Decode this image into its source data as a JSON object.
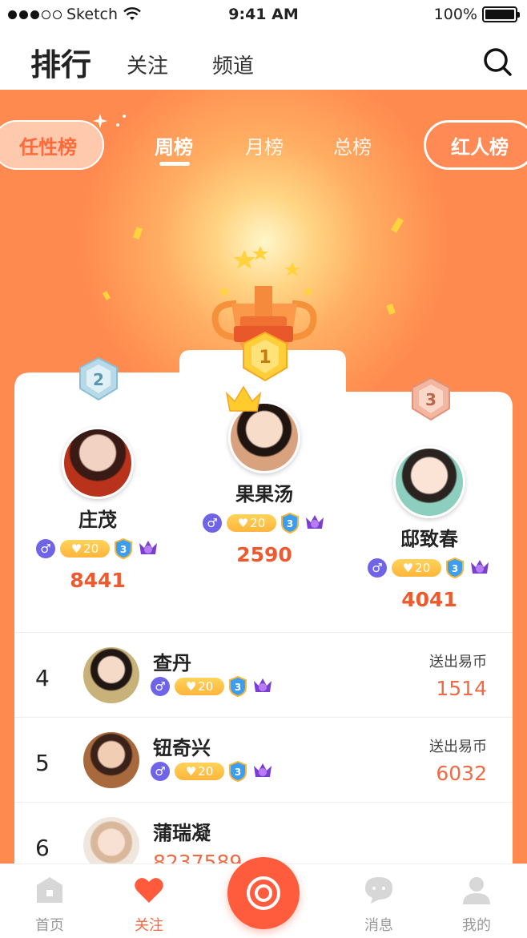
{
  "status_bar": {
    "carrier": "Sketch",
    "time": "9:41 AM",
    "battery": "100%"
  },
  "nav": {
    "title": "排行",
    "tabs": [
      "关注",
      "频道"
    ],
    "search_icon": "search-icon"
  },
  "header": {
    "left_pill": "任性榜",
    "right_pill": "红人榜",
    "range_tabs": [
      "周榜",
      "月榜",
      "总榜"
    ],
    "active_range": "周榜"
  },
  "podium": [
    {
      "rank": "2",
      "name": "庄茂",
      "gender": "♂",
      "likes": "20",
      "level": "3",
      "score": "8441"
    },
    {
      "rank": "1",
      "name": "果果汤",
      "gender": "♂",
      "likes": "20",
      "level": "3",
      "score": "2590"
    },
    {
      "rank": "3",
      "name": "邸致春",
      "gender": "♂",
      "likes": "20",
      "level": "3",
      "score": "4041"
    }
  ],
  "list": [
    {
      "rank": "4",
      "name": "查丹",
      "gender": "♂",
      "likes": "20",
      "level": "3",
      "label": "送出易币",
      "value": "1514"
    },
    {
      "rank": "5",
      "name": "钮奇兴",
      "gender": "♂",
      "likes": "20",
      "level": "3",
      "label": "送出易币",
      "value": "6032"
    },
    {
      "rank": "6",
      "name": "蒲瑞凝",
      "value": "8237589"
    }
  ],
  "tabbar": {
    "items": [
      "首页",
      "关注",
      "消息",
      "我的"
    ],
    "active": "关注"
  },
  "colors": {
    "accent": "#ff8a4f",
    "score": "#f0582d",
    "gender": "#6f63e8"
  }
}
